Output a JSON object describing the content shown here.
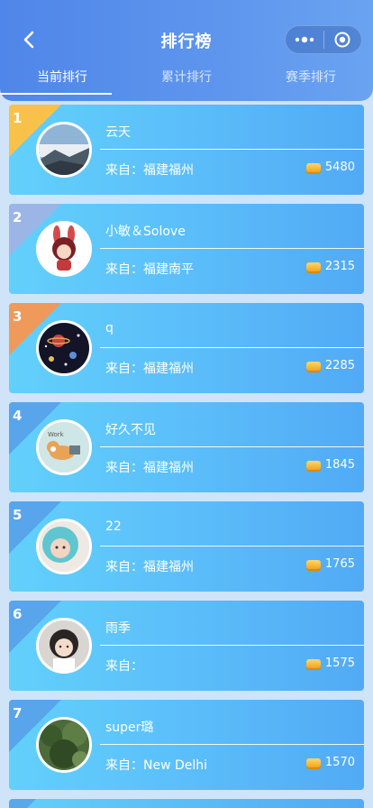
{
  "header": {
    "title": "排行榜",
    "back_icon": "chevron-left-icon",
    "menu_icon": "more-dots-icon",
    "close_icon": "target-circle-icon"
  },
  "tabs": [
    {
      "label": "当前排行",
      "active": true
    },
    {
      "label": "累计排行",
      "active": false
    },
    {
      "label": "赛季排行",
      "active": false
    }
  ],
  "from_prefix": "来自：",
  "ranking": [
    {
      "rank": "1",
      "name": "云天",
      "from": "来自：福建福州",
      "score": "5480",
      "corner_color": "#f8c24a",
      "avatar": "landscape"
    },
    {
      "rank": "2",
      "name": "小敏＆Solove",
      "from": "来自：福建南平",
      "score": "2315",
      "corner_color": "#9bb6e6",
      "avatar": "cartoon-girl"
    },
    {
      "rank": "3",
      "name": "q",
      "from": "来自：福建福州",
      "score": "2285",
      "corner_color": "#ef9a5a",
      "avatar": "space"
    },
    {
      "rank": "4",
      "name": "好久不见",
      "from": "来自：福建福州",
      "score": "1845",
      "corner_color": "#58a5ec",
      "avatar": "corgi"
    },
    {
      "rank": "5",
      "name": "22",
      "from": "来自：福建福州",
      "score": "1765",
      "corner_color": "#58a5ec",
      "avatar": "child-hood"
    },
    {
      "rank": "6",
      "name": "雨季",
      "from": "来自：",
      "score": "1575",
      "corner_color": "#58a5ec",
      "avatar": "girl-portrait"
    },
    {
      "rank": "7",
      "name": "super璐",
      "from": "来自：New Delhi",
      "score": "1570",
      "corner_color": "#58a5ec",
      "avatar": "plant"
    }
  ],
  "colors": {
    "header": "#5e96ee",
    "card_start": "#62d0fb",
    "card_end": "#52aaf5",
    "background": "#cfe4f8"
  }
}
